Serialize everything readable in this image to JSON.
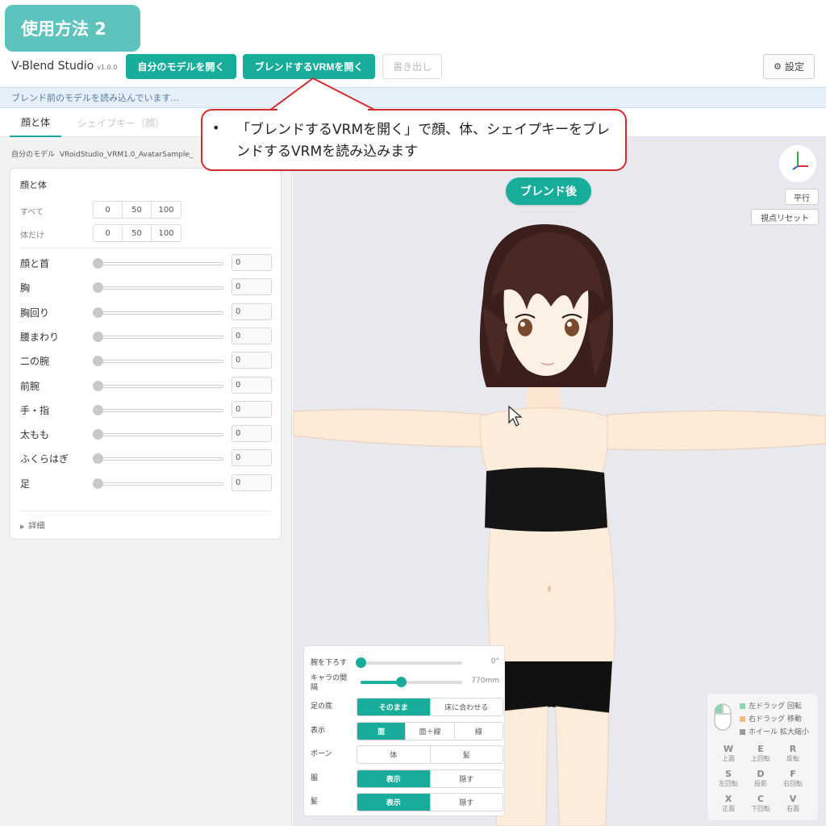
{
  "tutorial": {
    "label": "使用方法 2"
  },
  "app": {
    "name": "V-Blend Studio",
    "version": "v1.0.0"
  },
  "toolbar": {
    "open_own_model": "自分のモデルを開く",
    "open_blend_vrm": "ブレンドするVRMを開く",
    "export": "書き出し",
    "settings": "設定"
  },
  "status": {
    "message": "ブレンド前のモデルを読み込んでいます..."
  },
  "tabs": [
    {
      "label": "顔と体",
      "active": true
    },
    {
      "label": "シェイプキー（顔）",
      "active": false
    }
  ],
  "left_panel": {
    "model_label": "自分のモデル",
    "model_value": "VRoidStudio_VRM1.0_AvatarSample_",
    "card_title": "顔と体",
    "presets": [
      {
        "label": "すべて",
        "options": [
          "0",
          "50",
          "100"
        ]
      },
      {
        "label": "体だけ",
        "options": [
          "0",
          "50",
          "100"
        ]
      }
    ],
    "sliders": [
      {
        "label": "顔と首",
        "value": "0"
      },
      {
        "label": "胸",
        "value": "0"
      },
      {
        "label": "胸回り",
        "value": "0"
      },
      {
        "label": "腰まわり",
        "value": "0"
      },
      {
        "label": "二の腕",
        "value": "0"
      },
      {
        "label": "前腕",
        "value": "0"
      },
      {
        "label": "手・指",
        "value": "0"
      },
      {
        "label": "太もも",
        "value": "0"
      },
      {
        "label": "ふくらはぎ",
        "value": "0"
      },
      {
        "label": "足",
        "value": "0"
      }
    ],
    "details": "詳細"
  },
  "viewport": {
    "badge": "ブレンド後",
    "parallel": "平行",
    "reset_view": "視点リセット",
    "options": {
      "arm_down": {
        "label": "腕を下ろす",
        "value": "0°",
        "fraction": 0
      },
      "spacing": {
        "label": "キャラの間隔",
        "value": "770mm",
        "fraction": 0.4
      },
      "foot": {
        "label": "足の底",
        "options": [
          "そのまま",
          "床に合わせる"
        ],
        "selected": 0
      },
      "display": {
        "label": "表示",
        "options": [
          "面",
          "面＋線",
          "線"
        ],
        "selected": 0
      },
      "bone": {
        "label": "ボーン",
        "options": [
          "体",
          "髪"
        ],
        "selected": -1
      },
      "clothes": {
        "label": "服",
        "options": [
          "表示",
          "隠す"
        ],
        "selected": 0
      },
      "hair": {
        "label": "髪",
        "options": [
          "表示",
          "隠す"
        ],
        "selected": 0
      }
    },
    "help": {
      "legend": [
        {
          "text": "左ドラッグ 回転",
          "color": "#8fd3b0"
        },
        {
          "text": "右ドラッグ 移動",
          "color": "#f0c070"
        },
        {
          "text": "ホイール 拡大縮小",
          "color": "#9a9a9a"
        }
      ],
      "keys": [
        {
          "k": "W",
          "d": "上面"
        },
        {
          "k": "E",
          "d": "上回転"
        },
        {
          "k": "R",
          "d": "反転"
        },
        {
          "k": "S",
          "d": "左回転"
        },
        {
          "k": "D",
          "d": "投影"
        },
        {
          "k": "F",
          "d": "右回転"
        },
        {
          "k": "X",
          "d": "正面"
        },
        {
          "k": "C",
          "d": "下回転"
        },
        {
          "k": "V",
          "d": "右面"
        }
      ]
    }
  },
  "callout": {
    "bullet": "•",
    "text": "「ブレンドするVRMを開く」で顔、体、シェイプキーをブレンドするVRMを読み込みます"
  },
  "colors": {
    "accent": "#18ad9b",
    "callout_border": "#d52b2b",
    "status_bg": "#e6f0fb"
  }
}
